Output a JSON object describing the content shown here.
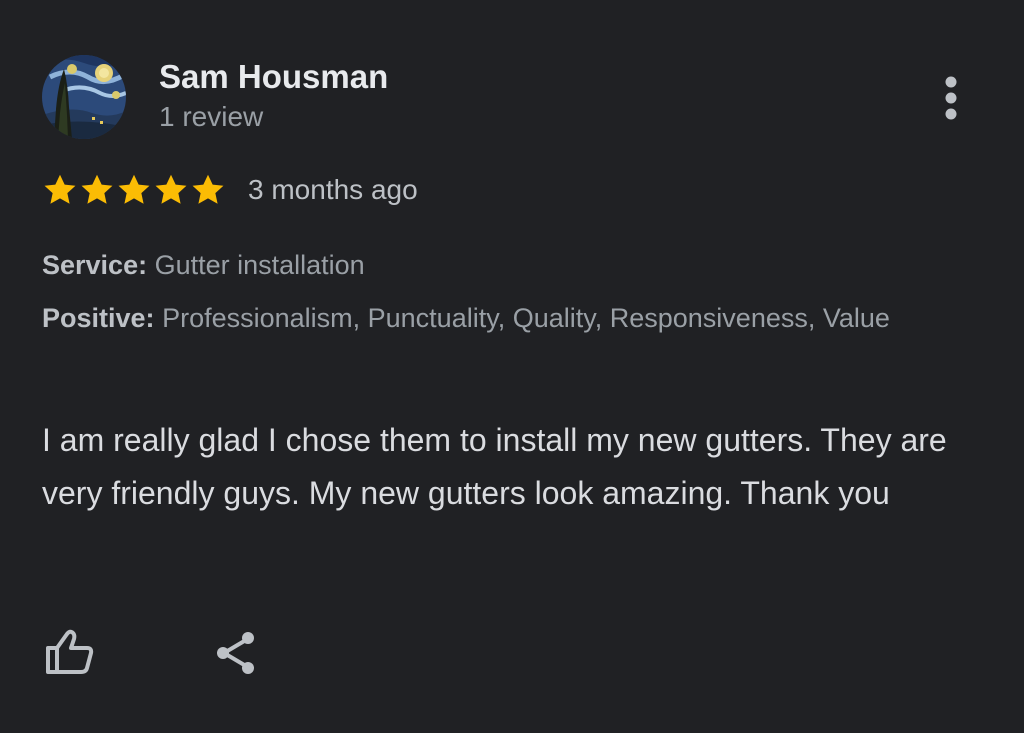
{
  "review": {
    "author_name": "Sam Housman",
    "review_count": "1 review",
    "avatar_icon": "starry-night-avatar",
    "rating": 5,
    "rating_max": 5,
    "date": "3 months ago",
    "service_label": "Service:",
    "service_value": "Gutter installation",
    "positive_label": "Positive:",
    "positive_value": "Professionalism, Punctuality, Quality, Responsiveness, Value",
    "text": "I am really glad I chose them to install my new gutters. They are very friendly guys. My new gutters look amazing. Thank you"
  },
  "actions": {
    "more_icon": "more-vertical-icon",
    "like_icon": "thumbs-up-icon",
    "share_icon": "share-icon"
  },
  "colors": {
    "background": "#202124",
    "star": "#fbbc04",
    "name": "#e8eaed",
    "secondary": "#9aa0a6",
    "body_text": "#dadce0",
    "icon": "#bdc1c6"
  }
}
